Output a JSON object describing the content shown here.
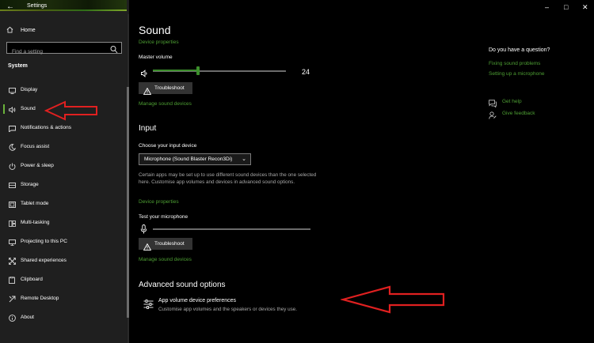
{
  "window": {
    "title": "Settings",
    "back_glyph": "←",
    "minimize_glyph": "–",
    "maximize_glyph": "□",
    "close_glyph": "✕"
  },
  "sidebar": {
    "home_label": "Home",
    "search_placeholder": "Find a setting",
    "section_label": "System",
    "items": [
      {
        "label": "Display",
        "icon": "display-icon"
      },
      {
        "label": "Sound",
        "icon": "speaker-icon",
        "selected": true
      },
      {
        "label": "Notifications & actions",
        "icon": "notifications-icon"
      },
      {
        "label": "Focus assist",
        "icon": "moon-icon"
      },
      {
        "label": "Power & sleep",
        "icon": "power-icon"
      },
      {
        "label": "Storage",
        "icon": "storage-icon"
      },
      {
        "label": "Tablet mode",
        "icon": "tablet-icon"
      },
      {
        "label": "Multi-tasking",
        "icon": "multitasking-icon"
      },
      {
        "label": "Projecting to this PC",
        "icon": "projector-icon"
      },
      {
        "label": "Shared experiences",
        "icon": "shared-icon"
      },
      {
        "label": "Clipboard",
        "icon": "clipboard-icon"
      },
      {
        "label": "Remote Desktop",
        "icon": "remote-desktop-icon"
      },
      {
        "label": "About",
        "icon": "info-icon"
      }
    ]
  },
  "main": {
    "title": "Sound",
    "output": {
      "device_properties_link": "Device properties",
      "master_volume_label": "Master volume",
      "master_volume_value": "24",
      "master_volume_level": 0.34,
      "troubleshoot_label": "Troubleshoot",
      "manage_devices_link": "Manage sound devices"
    },
    "input": {
      "heading": "Input",
      "choose_label": "Choose your input device",
      "selected_device": "Microphone (Sound Blaster Recon3Di)",
      "description": "Certain apps may be set up to use different sound devices than the one selected here. Customise app volumes and devices in advanced sound options.",
      "device_properties_link": "Device properties",
      "test_label": "Test your microphone",
      "troubleshoot_label": "Troubleshoot",
      "manage_devices_link": "Manage sound devices"
    },
    "advanced": {
      "heading": "Advanced sound options",
      "app_volume_title": "App volume  device preferences",
      "app_volume_subtitle": "Customise app volumes and the speakers or devices they use."
    }
  },
  "aside": {
    "question_heading": "Do you have a question?",
    "links": [
      "Fixing sound problems",
      "Setting up a microphone"
    ],
    "get_help": "Get help",
    "give_feedback": "Give feedback"
  },
  "colors": {
    "accent_green": "#4d9e33",
    "annotation_red": "#e02020",
    "sidebar_bg": "#1f1f1f",
    "main_bg": "#000000"
  }
}
